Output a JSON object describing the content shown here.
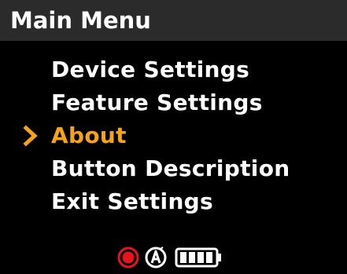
{
  "header": {
    "title": "Main Menu"
  },
  "menu": {
    "items": [
      {
        "label": "Device Settings",
        "selected": false
      },
      {
        "label": "Feature Settings",
        "selected": false
      },
      {
        "label": "About",
        "selected": true
      },
      {
        "label": "Button Description",
        "selected": false
      },
      {
        "label": "Exit Settings",
        "selected": false
      }
    ]
  },
  "status": {
    "icons": [
      "record-icon",
      "auto-mode-icon",
      "battery-icon"
    ],
    "battery_level": 1.0
  },
  "colors": {
    "background": "#000000",
    "header_background": "#2b2b2b",
    "text": "#ffffff",
    "selected": "#f5a31a",
    "record": "#e8141b"
  }
}
